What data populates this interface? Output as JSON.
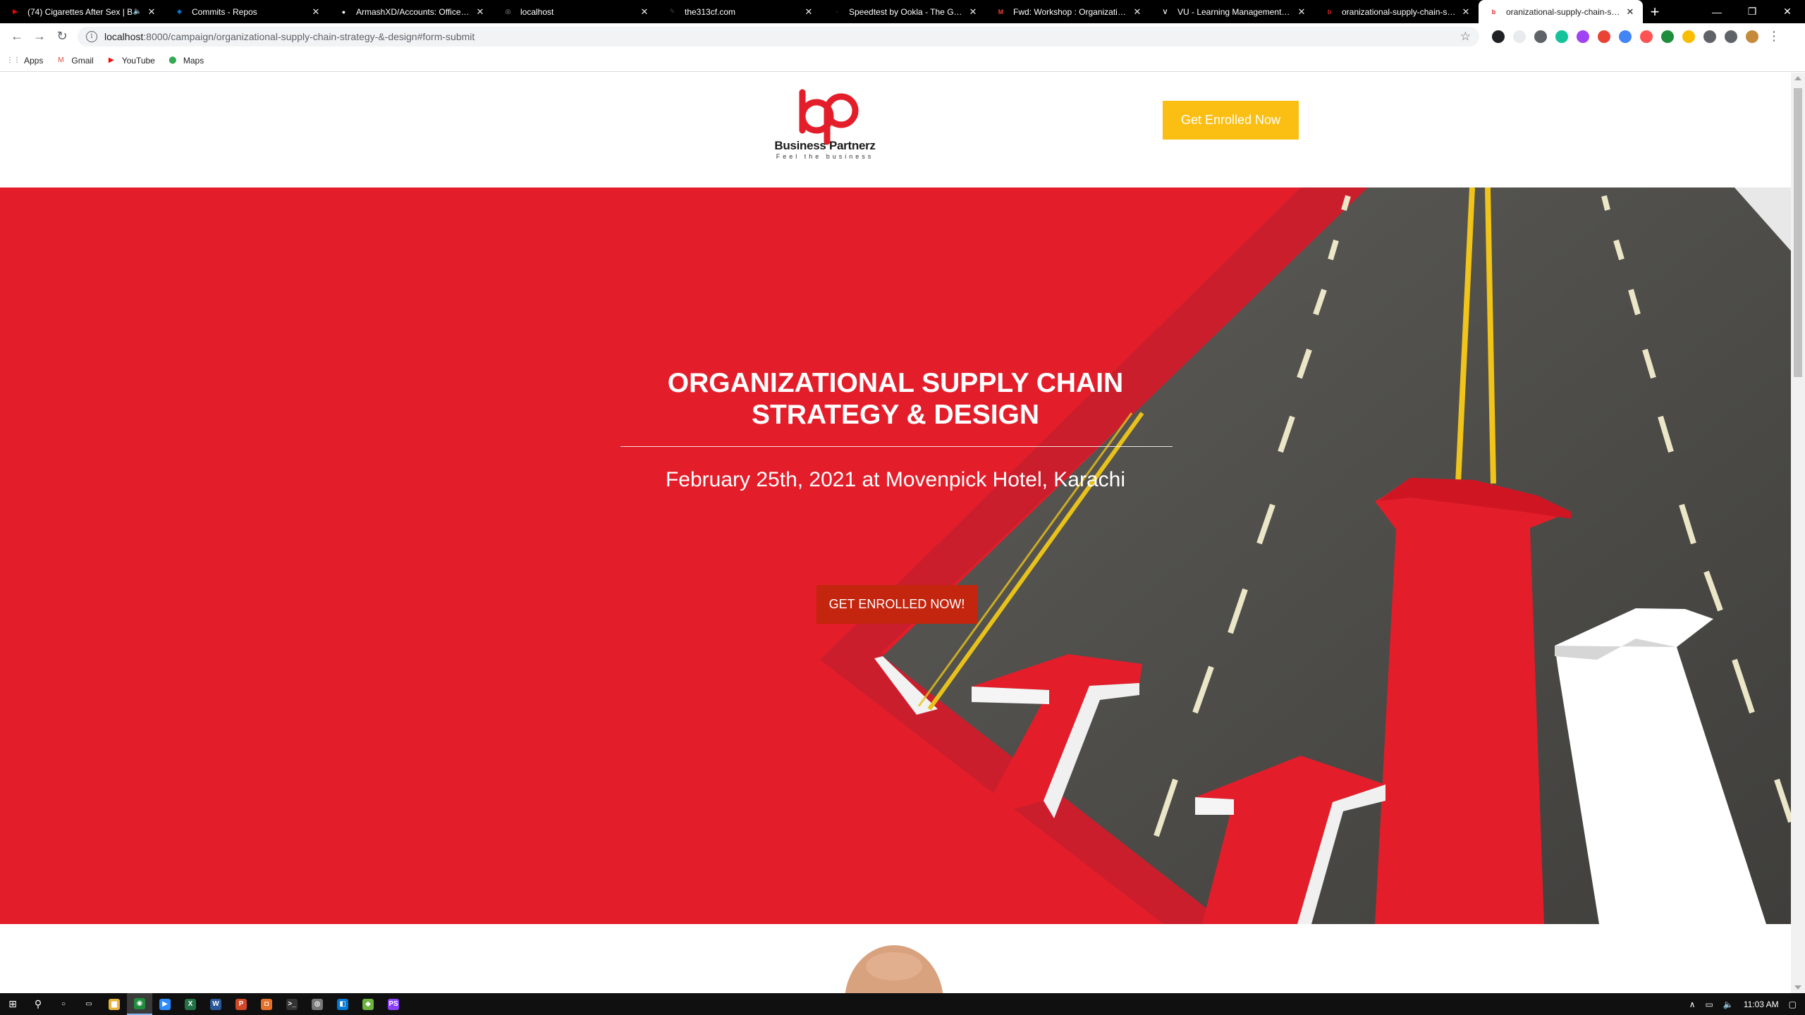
{
  "browser": {
    "tabs": [
      {
        "title": "(74) Cigarettes After Sex | B",
        "favicon": "youtube-icon",
        "color": "#ff0000",
        "glyph": "▶",
        "extra": "🔈"
      },
      {
        "title": "Commits - Repos",
        "favicon": "azure-devops-icon",
        "color": "#0078d4",
        "glyph": "◆"
      },
      {
        "title": "ArmashXD/Accounts: Office Pr",
        "favicon": "github-icon",
        "color": "#ffffff",
        "glyph": "●"
      },
      {
        "title": "localhost",
        "favicon": "globe-icon",
        "color": "#9aa0a6",
        "glyph": "◎"
      },
      {
        "title": "the313cf.com",
        "favicon": "site-icon",
        "color": "#444444",
        "glyph": "✎"
      },
      {
        "title": "Speedtest by Ookla - The Globa",
        "favicon": "speedtest-icon",
        "color": "#333333",
        "glyph": "◔"
      },
      {
        "title": "Fwd: Workshop : Organizationa",
        "favicon": "gmail-icon",
        "color": "#ea4335",
        "glyph": "M"
      },
      {
        "title": "VU - Learning Management Sys",
        "favicon": "vu-icon",
        "color": "#ffffff",
        "glyph": "V"
      },
      {
        "title": "oranizational-supply-chain-stra",
        "favicon": "bp-icon",
        "color": "#e31e2a",
        "glyph": "b"
      },
      {
        "title": "oranizational-supply-chain-stra",
        "favicon": "bp-icon",
        "color": "#e31e2a",
        "glyph": "b",
        "active": true
      }
    ],
    "new_tab": "+",
    "window_controls": {
      "minimize": "—",
      "restore": "❐",
      "close": "✕"
    },
    "nav": {
      "back": "←",
      "forward": "→",
      "reload": "↻"
    },
    "url": {
      "host": "localhost",
      "path": ":8000/campaign/organizational-supply-chain-strategy-&-design#form-submit"
    },
    "bookmarks": [
      {
        "label": "Apps",
        "icon": "apps-grid-icon",
        "glyph": "⋮⋮",
        "color": "#5f6368"
      },
      {
        "label": "Gmail",
        "icon": "gmail-icon",
        "glyph": "M",
        "color": "#ea4335"
      },
      {
        "label": "YouTube",
        "icon": "youtube-icon",
        "glyph": "▶",
        "color": "#ff0000"
      },
      {
        "label": "Maps",
        "icon": "maps-pin-icon",
        "glyph": "⬤",
        "color": "#34a853"
      }
    ],
    "extensions": [
      {
        "name": "ext-icon-1",
        "color": "#202124"
      },
      {
        "name": "ext-icon-2",
        "color": "#e8eaed"
      },
      {
        "name": "ext-icon-3",
        "color": "#5f6368"
      },
      {
        "name": "ext-icon-4",
        "color": "#15c39a"
      },
      {
        "name": "ext-icon-5",
        "color": "#a142f4"
      },
      {
        "name": "ext-icon-6",
        "color": "#ea4335"
      },
      {
        "name": "ext-icon-7",
        "color": "#4285f4"
      },
      {
        "name": "ext-icon-8",
        "color": "#ff5252"
      },
      {
        "name": "ext-icon-9",
        "color": "#1e8e3e"
      },
      {
        "name": "ext-icon-10",
        "color": "#fbbc04"
      },
      {
        "name": "ext-icon-11",
        "color": "#5f6368"
      },
      {
        "name": "ext-icon-12",
        "color": "#5f6368"
      },
      {
        "name": "ext-icon-13",
        "color": "#c58a3a"
      }
    ]
  },
  "site": {
    "logo": {
      "name": "Business Partnerz",
      "tagline": "Feel the business",
      "color": "#e31e2a"
    },
    "header_cta": "Get Enrolled Now",
    "hero": {
      "title_line1": "ORGANIZATIONAL SUPPLY CHAIN",
      "title_line2": "STRATEGY & DESIGN",
      "date_location": "February 25th, 2021 at Movenpick Hotel, Karachi",
      "cta": "GET ENROLLED NOW!"
    },
    "colors": {
      "hero_red": "#e31e2a",
      "cta_yellow": "#fbbf13",
      "cta_dark": "#c3250e"
    }
  },
  "taskbar": {
    "start": "⊞",
    "search": "⚲",
    "apps": [
      {
        "name": "cortana-icon",
        "glyph": "○",
        "color": "#101010"
      },
      {
        "name": "task-view-icon",
        "glyph": "▭",
        "color": "#101010"
      },
      {
        "name": "file-explorer-icon",
        "glyph": "▆",
        "color": "#e8b339"
      },
      {
        "name": "chrome-icon",
        "glyph": "◉",
        "color": "#1e8e3e",
        "active": true
      },
      {
        "name": "zoom-icon",
        "glyph": "▶",
        "color": "#2d8cff"
      },
      {
        "name": "excel-icon",
        "glyph": "X",
        "color": "#217346"
      },
      {
        "name": "word-icon",
        "glyph": "W",
        "color": "#2b579a"
      },
      {
        "name": "powerpoint-icon",
        "glyph": "P",
        "color": "#d24726"
      },
      {
        "name": "app-orange-icon",
        "glyph": "◘",
        "color": "#e8712a"
      },
      {
        "name": "terminal-icon",
        "glyph": ">_",
        "color": "#333333"
      },
      {
        "name": "app-circle-icon",
        "glyph": "◍",
        "color": "#777777"
      },
      {
        "name": "vscode-icon",
        "glyph": "◧",
        "color": "#0078d4"
      },
      {
        "name": "app-diamond-icon",
        "glyph": "◆",
        "color": "#6db33f"
      },
      {
        "name": "phpstorm-icon",
        "glyph": "PS",
        "color": "#8a3ffc"
      }
    ],
    "tray": {
      "chevron": "∧",
      "network": "▭",
      "volume": "🔈",
      "time": "11:03 AM",
      "notifications": "▢"
    }
  }
}
